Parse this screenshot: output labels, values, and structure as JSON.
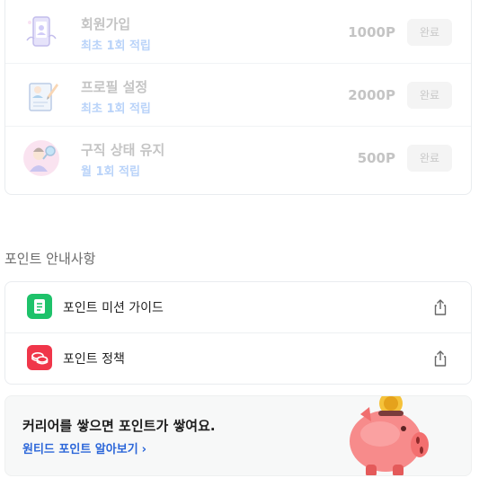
{
  "missions": [
    {
      "title": "회원가입",
      "subtitle": "최초 1회 적립",
      "points": "1000P",
      "button": "완료",
      "icon": "phone-signup-icon"
    },
    {
      "title": "프로필 설정",
      "subtitle": "최초 1회 적립",
      "points": "2000P",
      "button": "완료",
      "icon": "profile-document-icon"
    },
    {
      "title": "구직 상태 유지",
      "subtitle": "월 1회 적립",
      "points": "500P",
      "button": "완료",
      "icon": "job-search-person-icon"
    }
  ],
  "info_section": {
    "title": "포인트 안내사항",
    "items": [
      {
        "label": "포인트 미션 가이드",
        "icon": "guide-document-icon",
        "icon_color": "#1ec26a",
        "action_icon": "share-icon"
      },
      {
        "label": "포인트 정책",
        "icon": "coins-icon",
        "icon_color": "#f0364a",
        "action_icon": "share-icon"
      }
    ]
  },
  "banner": {
    "title": "커리어를 쌓으면 포인트가 쌓여요.",
    "link": "원티드 포인트 알아보기",
    "link_icon": "chevron-right-icon",
    "illustration": "piggy-bank-icon",
    "link_color": "#2b66d9"
  }
}
